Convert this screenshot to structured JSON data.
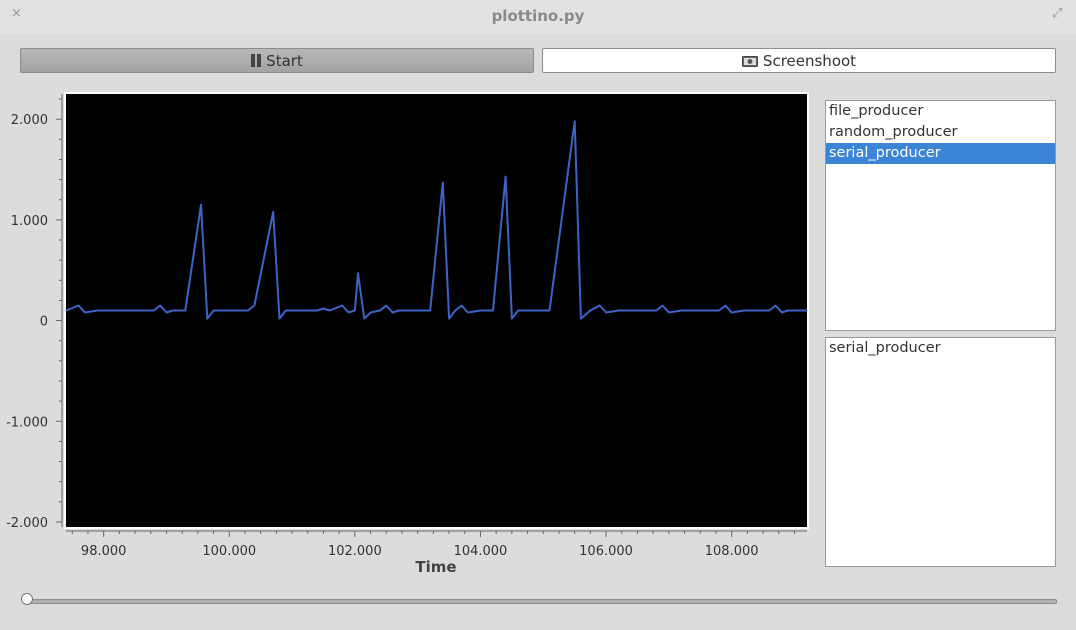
{
  "window": {
    "title": "plottino.py",
    "close_glyph": "×",
    "maximize_glyph": "⤢"
  },
  "toolbar": {
    "start_label": "Start",
    "start_icon": "pause-icon",
    "screenshot_label": "Screenshoot",
    "screenshot_icon": "camera-icon"
  },
  "producers": {
    "items": [
      "file_producer",
      "random_producer",
      "serial_producer"
    ],
    "selected": "serial_producer"
  },
  "active_producers": {
    "items": [
      "serial_producer"
    ]
  },
  "slider": {
    "value": 0
  },
  "colors": {
    "line": "#3d63c9",
    "plot_bg": "#000000",
    "selection": "#3b84d6"
  },
  "chart_data": {
    "type": "line",
    "xlabel": "Time",
    "ylabel": "",
    "xlim": [
      97.4,
      109.2
    ],
    "ylim": [
      -2.05,
      2.25
    ],
    "x_ticks": [
      98,
      100,
      102,
      104,
      106,
      108
    ],
    "x_tick_labels": [
      "98.000",
      "100.000",
      "102.000",
      "104.000",
      "106.000",
      "108.000"
    ],
    "y_ticks": [
      2,
      1,
      0,
      -1,
      -2
    ],
    "y_tick_labels": [
      "2.000",
      "1.000",
      "0",
      "-1.000",
      "-2.000"
    ],
    "grid": false,
    "series": [
      {
        "color": "#3d63c9",
        "x": [
          97.4,
          97.6,
          97.7,
          97.9,
          98.0,
          98.2,
          98.4,
          98.6,
          98.8,
          98.9,
          99.0,
          99.1,
          99.2,
          99.3,
          99.55,
          99.65,
          99.75,
          99.9,
          100.0,
          100.1,
          100.3,
          100.4,
          100.7,
          100.8,
          100.9,
          101.0,
          101.2,
          101.4,
          101.5,
          101.6,
          101.8,
          101.9,
          102.0,
          102.05,
          102.15,
          102.25,
          102.4,
          102.5,
          102.6,
          102.7,
          102.8,
          103.0,
          103.2,
          103.4,
          103.5,
          103.6,
          103.7,
          103.8,
          104.0,
          104.2,
          104.4,
          104.5,
          104.6,
          104.7,
          104.9,
          105.1,
          105.5,
          105.6,
          105.75,
          105.9,
          106.0,
          106.2,
          106.4,
          106.6,
          106.8,
          106.9,
          107.0,
          107.2,
          107.4,
          107.6,
          107.8,
          107.9,
          108.0,
          108.2,
          108.4,
          108.6,
          108.7,
          108.8,
          108.9,
          109.0,
          109.2
        ],
        "y": [
          0.1,
          0.15,
          0.08,
          0.1,
          0.1,
          0.1,
          0.1,
          0.1,
          0.1,
          0.15,
          0.08,
          0.1,
          0.1,
          0.1,
          1.15,
          0.02,
          0.1,
          0.1,
          0.1,
          0.1,
          0.1,
          0.15,
          1.08,
          0.02,
          0.1,
          0.1,
          0.1,
          0.1,
          0.12,
          0.1,
          0.15,
          0.08,
          0.1,
          0.47,
          0.02,
          0.08,
          0.1,
          0.15,
          0.08,
          0.1,
          0.1,
          0.1,
          0.1,
          1.37,
          0.02,
          0.1,
          0.15,
          0.08,
          0.1,
          0.1,
          1.43,
          0.02,
          0.1,
          0.1,
          0.1,
          0.1,
          1.98,
          0.02,
          0.1,
          0.15,
          0.08,
          0.1,
          0.1,
          0.1,
          0.1,
          0.15,
          0.08,
          0.1,
          0.1,
          0.1,
          0.1,
          0.15,
          0.08,
          0.1,
          0.1,
          0.1,
          0.15,
          0.08,
          0.1,
          0.1,
          0.1
        ]
      }
    ]
  }
}
